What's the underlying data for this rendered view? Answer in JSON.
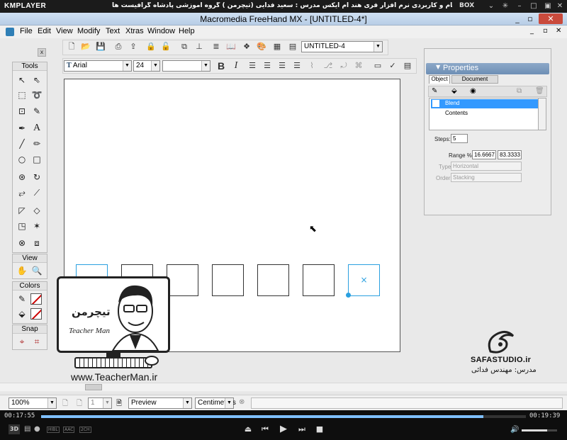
{
  "player": {
    "logo": "KMPLAYER",
    "title": "مجموعه آموزشی جامع ، گام به گام و کاربردی نرم افزار فری هند ام ایکس   مدرس : سعید فدایی (تیچرمن ) گروه آموزشی پادشاه گرافیست ها",
    "box": "BOX",
    "time_elapsed": "00:17:55",
    "time_total": "00:19:39",
    "progress": 0.912,
    "volume": 0.72,
    "badges": [
      "3D",
      "HIBL",
      "AAC",
      "2CH"
    ]
  },
  "app": {
    "title": "Macromedia FreeHand MX - [UNTITLED-4*]",
    "menus": [
      "File",
      "Edit",
      "View",
      "Modify",
      "Text",
      "Xtras",
      "Window",
      "Help"
    ]
  },
  "toolbar": {
    "document_select": "UNTITLED-4",
    "font": "Arial",
    "size": "24",
    "style": ""
  },
  "tools_panel": {
    "title": "Tools",
    "view_title": "View",
    "colors_title": "Colors",
    "snap_title": "Snap"
  },
  "properties": {
    "title": "Properties",
    "tabs": [
      "Object",
      "Document"
    ],
    "tree": [
      "Blend",
      "Contents"
    ],
    "steps_label": "Steps:",
    "steps_value": "5",
    "range_label": "Range %:",
    "range_from": "16.6667",
    "range_to": "83.3333",
    "type_label": "Type:",
    "type_value": "Horizontal",
    "order_label": "Order:",
    "order_value": "Stacking"
  },
  "watermark": {
    "site": "www.TeacherMan.ir",
    "logo_fa": "تیچرمن",
    "logo_en": "Teacher Man",
    "studio": "SAFASTUDIO.ir",
    "teacher": "مدرس: مهندس فدائی"
  },
  "status": {
    "zoom": "100%",
    "page": "1",
    "view_mode": "Preview",
    "units": "Centimeters"
  },
  "colors": {
    "selection": "#2aa0e0",
    "tree_selected": "#3399ff"
  }
}
